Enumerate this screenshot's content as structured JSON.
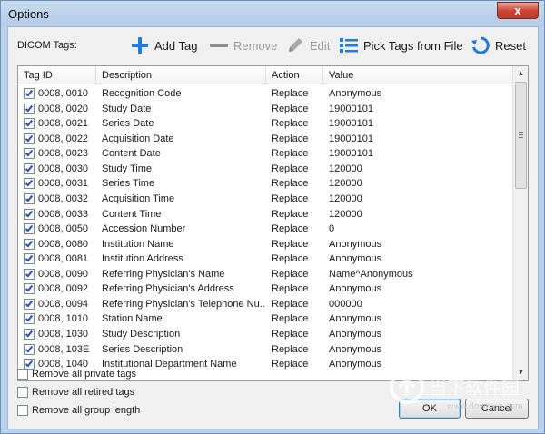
{
  "window": {
    "title": "Options",
    "close_glyph": "x"
  },
  "toolbar": {
    "label": "DICOM Tags:",
    "add_tag": "Add Tag",
    "remove": "Remove",
    "edit": "Edit",
    "pick_tags": "Pick Tags from File",
    "reset": "Reset"
  },
  "table": {
    "columns": [
      "Tag ID",
      "Description",
      "Action",
      "Value"
    ],
    "rows": [
      {
        "checked": true,
        "tag": "0008, 0010",
        "desc": "Recognition Code",
        "action": "Replace",
        "value": "Anonymous"
      },
      {
        "checked": true,
        "tag": "0008, 0020",
        "desc": "Study Date",
        "action": "Replace",
        "value": "19000101"
      },
      {
        "checked": true,
        "tag": "0008, 0021",
        "desc": "Series Date",
        "action": "Replace",
        "value": "19000101"
      },
      {
        "checked": true,
        "tag": "0008, 0022",
        "desc": "Acquisition Date",
        "action": "Replace",
        "value": "19000101"
      },
      {
        "checked": true,
        "tag": "0008, 0023",
        "desc": "Content Date",
        "action": "Replace",
        "value": "19000101"
      },
      {
        "checked": true,
        "tag": "0008, 0030",
        "desc": "Study Time",
        "action": "Replace",
        "value": "120000"
      },
      {
        "checked": true,
        "tag": "0008, 0031",
        "desc": "Series Time",
        "action": "Replace",
        "value": "120000"
      },
      {
        "checked": true,
        "tag": "0008, 0032",
        "desc": "Acquisition Time",
        "action": "Replace",
        "value": "120000"
      },
      {
        "checked": true,
        "tag": "0008, 0033",
        "desc": "Content Time",
        "action": "Replace",
        "value": "120000"
      },
      {
        "checked": true,
        "tag": "0008, 0050",
        "desc": "Accession Number",
        "action": "Replace",
        "value": "0"
      },
      {
        "checked": true,
        "tag": "0008, 0080",
        "desc": "Institution Name",
        "action": "Replace",
        "value": "Anonymous"
      },
      {
        "checked": true,
        "tag": "0008, 0081",
        "desc": "Institution Address",
        "action": "Replace",
        "value": "Anonymous"
      },
      {
        "checked": true,
        "tag": "0008, 0090",
        "desc": "Referring Physician's Name",
        "action": "Replace",
        "value": "Name^Anonymous"
      },
      {
        "checked": true,
        "tag": "0008, 0092",
        "desc": "Referring Physician's Address",
        "action": "Replace",
        "value": "Anonymous"
      },
      {
        "checked": true,
        "tag": "0008, 0094",
        "desc": "Referring Physician's Telephone Nu...",
        "action": "Replace",
        "value": "000000"
      },
      {
        "checked": true,
        "tag": "0008, 1010",
        "desc": "Station Name",
        "action": "Replace",
        "value": "Anonymous"
      },
      {
        "checked": true,
        "tag": "0008, 1030",
        "desc": "Study Description",
        "action": "Replace",
        "value": "Anonymous"
      },
      {
        "checked": true,
        "tag": "0008, 103E",
        "desc": "Series Description",
        "action": "Replace",
        "value": "Anonymous"
      },
      {
        "checked": true,
        "tag": "0008, 1040",
        "desc": "Institutional Department Name",
        "action": "Replace",
        "value": "Anonymous"
      }
    ]
  },
  "options": [
    {
      "label": "Remove all private tags",
      "checked": false
    },
    {
      "label": "Remove all retired tags",
      "checked": false
    },
    {
      "label": "Remove all group length",
      "checked": false
    }
  ],
  "buttons": {
    "ok": "OK",
    "cancel": "Cancel"
  },
  "watermark": {
    "text": "当下软件园",
    "url": "www.downxia.com"
  },
  "colors": {
    "accent": "#1e7be0",
    "disabled": "#9a9a9a",
    "title_bg": "#b9d1ea"
  }
}
